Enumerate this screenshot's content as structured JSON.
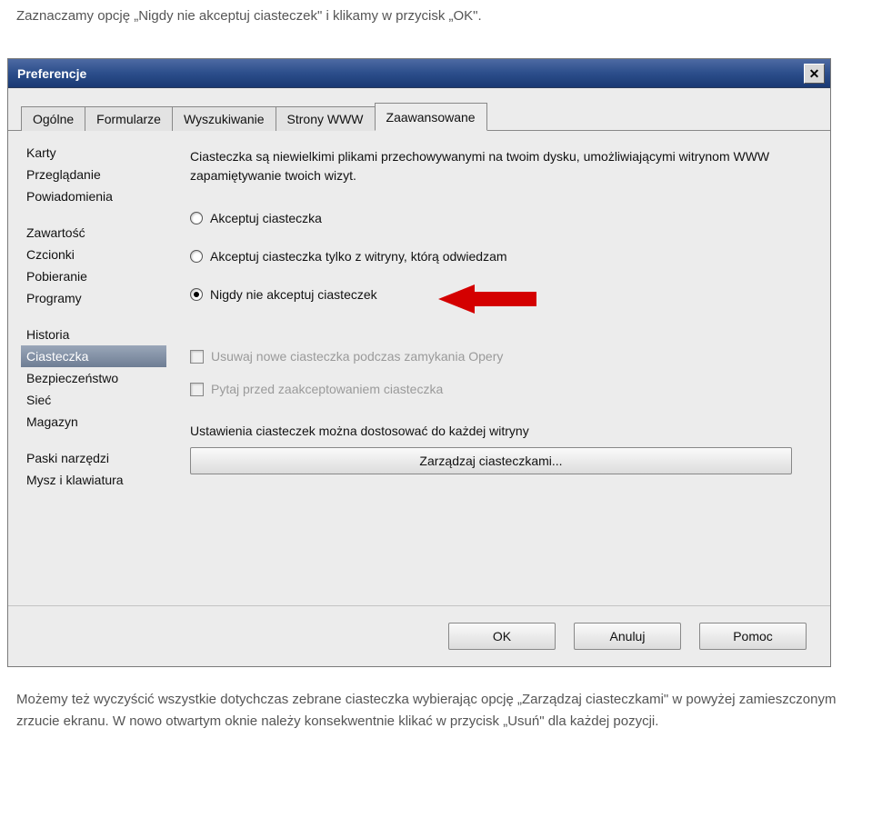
{
  "instruction_top": "Zaznaczamy opcję „Nigdy nie akceptuj ciasteczek\" i klikamy w przycisk „OK\".",
  "instruction_bottom_1": "Możemy też wyczyścić wszystkie dotychczas zebrane ciasteczka wybierając opcję „Zarządzaj ciasteczkami\" w powyżej zamieszczonym zrzucie ekranu. W nowo otwartym oknie należy konsekwentnie klikać w przycisk „Usuń\" dla każdej pozycji.",
  "dialog": {
    "title": "Preferencje",
    "tabs": [
      "Ogólne",
      "Formularze",
      "Wyszukiwanie",
      "Strony WWW",
      "Zaawansowane"
    ],
    "active_tab": "Zaawansowane",
    "sidebar": {
      "group1": [
        "Karty",
        "Przeglądanie",
        "Powiadomienia"
      ],
      "group2": [
        "Zawartość",
        "Czcionki",
        "Pobieranie",
        "Programy"
      ],
      "group3": [
        "Historia",
        "Ciasteczka",
        "Bezpieczeństwo",
        "Sieć",
        "Magazyn"
      ],
      "group4": [
        "Paski narzędzi",
        "Mysz i klawiatura"
      ],
      "selected": "Ciasteczka"
    },
    "pane": {
      "description": "Ciasteczka są niewielkimi plikami przechowywanymi na twoim dysku, umożliwiającymi witrynom WWW zapamiętywanie twoich wizyt.",
      "radios": [
        {
          "label": "Akceptuj ciasteczka",
          "checked": false
        },
        {
          "label": "Akceptuj ciasteczka tylko z witryny, którą odwiedzam",
          "checked": false
        },
        {
          "label": "Nigdy nie akceptuj ciasteczek",
          "checked": true
        }
      ],
      "checks": [
        {
          "label": "Usuwaj nowe ciasteczka podczas zamykania Opery"
        },
        {
          "label": "Pytaj przed zaakceptowaniem ciasteczka"
        }
      ],
      "note": "Ustawienia ciasteczek można dostosować do każdej witryny",
      "manage_button": "Zarządzaj ciasteczkami..."
    },
    "footer": {
      "ok": "OK",
      "cancel": "Anuluj",
      "help": "Pomoc"
    }
  }
}
